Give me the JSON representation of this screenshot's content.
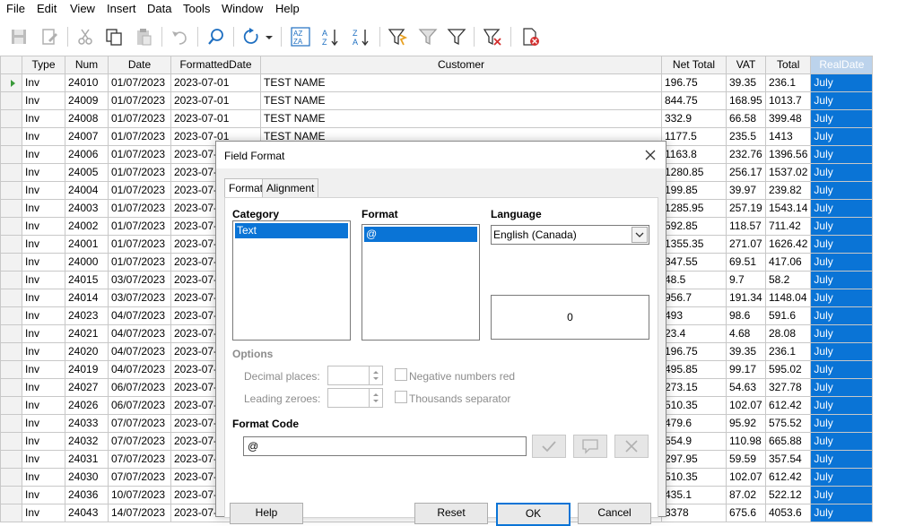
{
  "menu": [
    "File",
    "Edit",
    "View",
    "Insert",
    "Data",
    "Tools",
    "Window",
    "Help"
  ],
  "table": {
    "headers": [
      "Type",
      "Num",
      "Date",
      "FormattedDate",
      "Customer",
      "Net Total",
      "VAT",
      "Total",
      "RealDate"
    ],
    "rows": [
      [
        "Inv",
        "24010",
        "01/07/2023",
        "2023-07-01",
        "TEST NAME",
        "196.75",
        "39.35",
        "236.1",
        "July"
      ],
      [
        "Inv",
        "24009",
        "01/07/2023",
        "2023-07-01",
        "TEST NAME",
        "844.75",
        "168.95",
        "1013.7",
        "July"
      ],
      [
        "Inv",
        "24008",
        "01/07/2023",
        "2023-07-01",
        "TEST NAME",
        "332.9",
        "66.58",
        "399.48",
        "July"
      ],
      [
        "Inv",
        "24007",
        "01/07/2023",
        "2023-07-01",
        "TEST NAME",
        "1177.5",
        "235.5",
        "1413",
        "July"
      ],
      [
        "Inv",
        "24006",
        "01/07/2023",
        "2023-07-",
        "",
        "1163.8",
        "232.76",
        "1396.56",
        "July"
      ],
      [
        "Inv",
        "24005",
        "01/07/2023",
        "2023-07-",
        "",
        "1280.85",
        "256.17",
        "1537.02",
        "July"
      ],
      [
        "Inv",
        "24004",
        "01/07/2023",
        "2023-07-",
        "",
        "199.85",
        "39.97",
        "239.82",
        "July"
      ],
      [
        "Inv",
        "24003",
        "01/07/2023",
        "2023-07-",
        "",
        "1285.95",
        "257.19",
        "1543.14",
        "July"
      ],
      [
        "Inv",
        "24002",
        "01/07/2023",
        "2023-07-",
        "",
        "592.85",
        "118.57",
        "711.42",
        "July"
      ],
      [
        "Inv",
        "24001",
        "01/07/2023",
        "2023-07-",
        "",
        "1355.35",
        "271.07",
        "1626.42",
        "July"
      ],
      [
        "Inv",
        "24000",
        "01/07/2023",
        "2023-07-",
        "",
        "347.55",
        "69.51",
        "417.06",
        "July"
      ],
      [
        "Inv",
        "24015",
        "03/07/2023",
        "2023-07-",
        "",
        "48.5",
        "9.7",
        "58.2",
        "July"
      ],
      [
        "Inv",
        "24014",
        "03/07/2023",
        "2023-07-",
        "",
        "956.7",
        "191.34",
        "1148.04",
        "July"
      ],
      [
        "Inv",
        "24023",
        "04/07/2023",
        "2023-07-",
        "",
        "493",
        "98.6",
        "591.6",
        "July"
      ],
      [
        "Inv",
        "24021",
        "04/07/2023",
        "2023-07-",
        "",
        "23.4",
        "4.68",
        "28.08",
        "July"
      ],
      [
        "Inv",
        "24020",
        "04/07/2023",
        "2023-07-",
        "",
        "196.75",
        "39.35",
        "236.1",
        "July"
      ],
      [
        "Inv",
        "24019",
        "04/07/2023",
        "2023-07-",
        "",
        "495.85",
        "99.17",
        "595.02",
        "July"
      ],
      [
        "Inv",
        "24027",
        "06/07/2023",
        "2023-07-",
        "",
        "273.15",
        "54.63",
        "327.78",
        "July"
      ],
      [
        "Inv",
        "24026",
        "06/07/2023",
        "2023-07-",
        "",
        "510.35",
        "102.07",
        "612.42",
        "July"
      ],
      [
        "Inv",
        "24033",
        "07/07/2023",
        "2023-07-",
        "",
        "479.6",
        "95.92",
        "575.52",
        "July"
      ],
      [
        "Inv",
        "24032",
        "07/07/2023",
        "2023-07-",
        "",
        "554.9",
        "110.98",
        "665.88",
        "July"
      ],
      [
        "Inv",
        "24031",
        "07/07/2023",
        "2023-07-",
        "",
        "297.95",
        "59.59",
        "357.54",
        "July"
      ],
      [
        "Inv",
        "24030",
        "07/07/2023",
        "2023-07-",
        "",
        "510.35",
        "102.07",
        "612.42",
        "July"
      ],
      [
        "Inv",
        "24036",
        "10/07/2023",
        "2023-07-",
        "",
        "435.1",
        "87.02",
        "522.12",
        "July"
      ],
      [
        "Inv",
        "24043",
        "14/07/2023",
        "2023-07-",
        "",
        "3378",
        "675.6",
        "4053.6",
        "July"
      ]
    ]
  },
  "dialog": {
    "title": "Field Format",
    "tabs": [
      "Format",
      "Alignment"
    ],
    "category_label": "Category",
    "category_selected": "Text",
    "format_label": "Format",
    "format_selected": "@",
    "language_label": "Language",
    "language_value": "English (Canada)",
    "preview_value": "0",
    "options_label": "Options",
    "decimal_places_label": "Decimal places:",
    "leading_zeroes_label": "Leading zeroes:",
    "negative_red_label": "Negative numbers red",
    "thousands_sep_label": "Thousands separator",
    "format_code_label": "Format Code",
    "format_code_value": "@",
    "buttons": {
      "help": "Help",
      "reset": "Reset",
      "ok": "OK",
      "cancel": "Cancel"
    }
  },
  "colors": {
    "selection": "#0a74d6",
    "header_selected": "#bcd3ec"
  }
}
